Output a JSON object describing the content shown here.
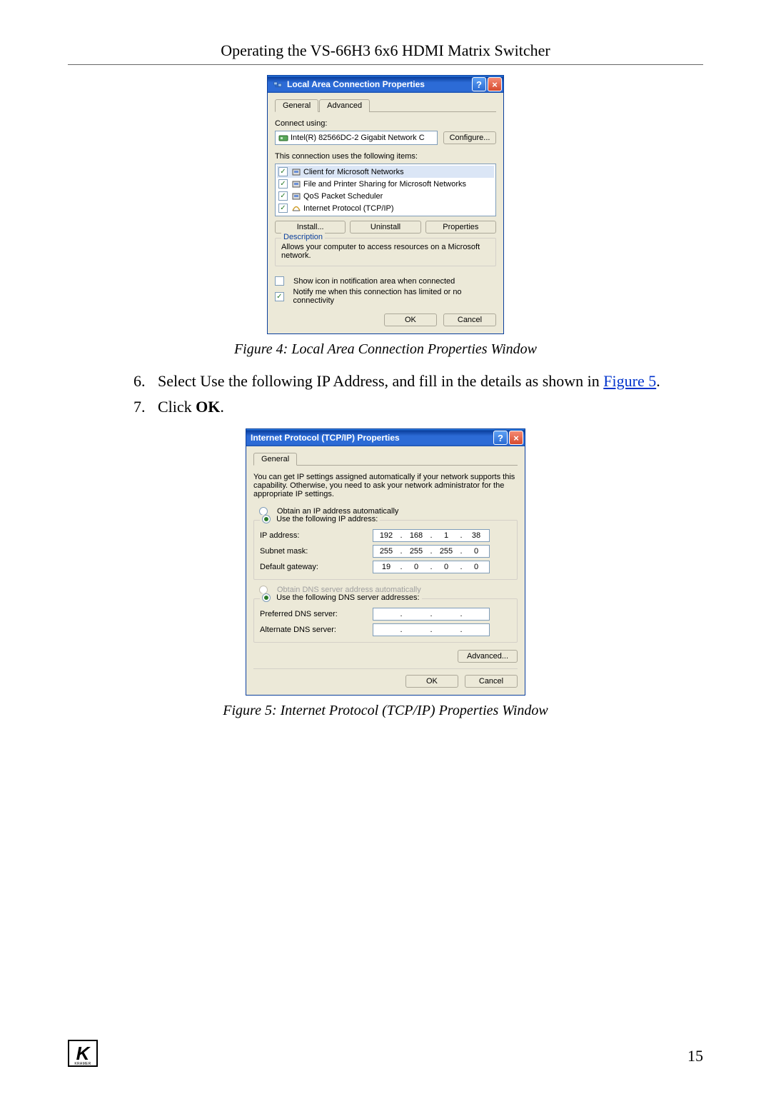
{
  "header": "Operating the VS-66H3 6x6 HDMI Matrix Switcher",
  "page_number": "15",
  "dialog1": {
    "title": "Local Area Connection Properties",
    "tabs": [
      "General",
      "Advanced"
    ],
    "connect_using_label": "Connect using:",
    "adapter": "Intel(R) 82566DC-2 Gigabit Network C",
    "configure_btn": "Configure...",
    "uses_label": "This connection uses the following items:",
    "items": [
      "Client for Microsoft Networks",
      "File and Printer Sharing for Microsoft Networks",
      "QoS Packet Scheduler",
      "Internet Protocol (TCP/IP)"
    ],
    "install_btn": "Install...",
    "uninstall_btn": "Uninstall",
    "properties_btn": "Properties",
    "description_legend": "Description",
    "description_text": "Allows your computer to access resources on a Microsoft network.",
    "show_icon": "Show icon in notification area when connected",
    "notify": "Notify me when this connection has limited or no connectivity",
    "ok": "OK",
    "cancel": "Cancel"
  },
  "caption1": "Figure 4: Local Area Connection Properties Window",
  "steps": {
    "s6_num": "6.",
    "s6_a": "Select Use the following IP Address, and fill in the details as shown in ",
    "s6_link": "Figure 5",
    "s6_dot": ".",
    "s7_num": "7.",
    "s7_a": "Click ",
    "s7_bold": "OK",
    "s7_dot": "."
  },
  "dialog2": {
    "title": "Internet Protocol (TCP/IP) Properties",
    "tab": "General",
    "intro": "You can get IP settings assigned automatically if your network supports this capability. Otherwise, you need to ask your network administrator for the appropriate IP settings.",
    "obtain_ip": "Obtain an IP address automatically",
    "use_ip": "Use the following IP address:",
    "ip_label": "IP address:",
    "ip": [
      "192",
      "168",
      "1",
      "38"
    ],
    "subnet_label": "Subnet mask:",
    "subnet": [
      "255",
      "255",
      "255",
      "0"
    ],
    "gateway_label": "Default gateway:",
    "gateway": [
      "19",
      "0",
      "0",
      "0"
    ],
    "obtain_dns": "Obtain DNS server address automatically",
    "use_dns": "Use the following DNS server addresses:",
    "pref_dns_label": "Preferred DNS server:",
    "alt_dns_label": "Alternate DNS server:",
    "advanced_btn": "Advanced...",
    "ok": "OK",
    "cancel": "Cancel"
  },
  "caption2": "Figure 5: Internet Protocol (TCP/IP) Properties Window",
  "logo": {
    "letter": "K",
    "brand": "KRAMER"
  }
}
